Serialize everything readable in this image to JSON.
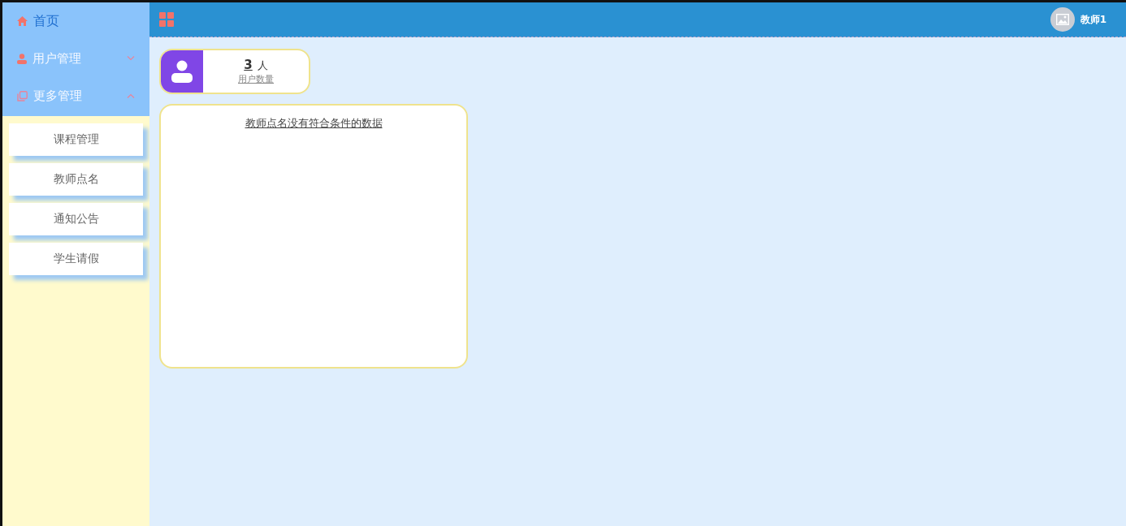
{
  "sidebar": {
    "items": [
      {
        "kind": "link",
        "label": "首页",
        "selected": true
      },
      {
        "kind": "group",
        "label": "用户管理",
        "selected": false,
        "expanded": false
      },
      {
        "kind": "group",
        "label": "更多管理",
        "selected": false,
        "expanded": true,
        "children": [
          {
            "label": "课程管理"
          },
          {
            "label": "教师点名"
          },
          {
            "label": "通知公告"
          },
          {
            "label": "学生请假"
          }
        ]
      }
    ]
  },
  "header": {
    "user": "教师1"
  },
  "stat_card": {
    "value": "3",
    "unit": "人",
    "label": "用户数量"
  },
  "panel": {
    "message": "教师点名没有符合条件的数据"
  }
}
